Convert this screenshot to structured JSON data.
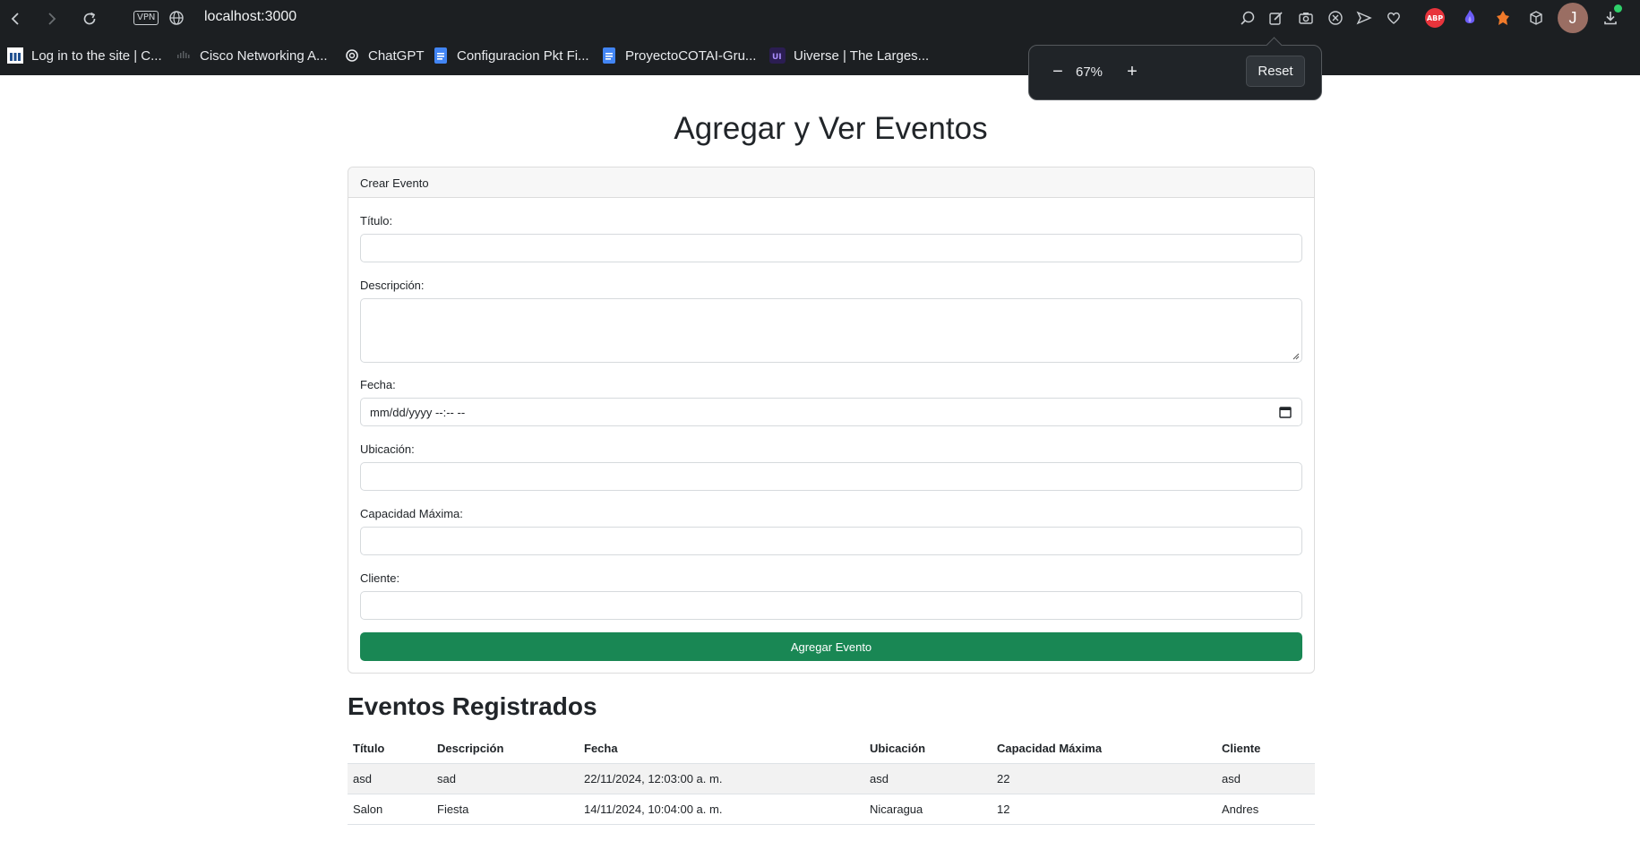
{
  "browser": {
    "url": "localhost:3000",
    "vpn_label": "VPN",
    "avatar_letter": "J",
    "abp_label": "ABP",
    "bookmarks": [
      {
        "label": "Log in to the site | C...",
        "icon": "moodle-icon"
      },
      {
        "label": "Cisco Networking A...",
        "icon": "cisco-icon"
      },
      {
        "label": "ChatGPT",
        "icon": "chatgpt-icon"
      },
      {
        "label": "Configuracion Pkt Fi...",
        "icon": "google-docs-icon"
      },
      {
        "label": "ProyectoCOTAI-Gru...",
        "icon": "google-docs-icon"
      },
      {
        "label": "Uiverse | The Larges...",
        "icon": "uiverse-icon"
      }
    ],
    "zoom": {
      "level": "67%",
      "minus": "−",
      "plus": "+",
      "reset_label": "Reset"
    }
  },
  "page": {
    "title": "Agregar y Ver Eventos",
    "form": {
      "header": "Crear Evento",
      "titulo_label": "Título:",
      "descripcion_label": "Descripción:",
      "fecha_label": "Fecha:",
      "fecha_placeholder": "mm/dd/yyyy --:-- --",
      "ubicacion_label": "Ubicación:",
      "capacidad_label": "Capacidad Máxima:",
      "cliente_label": "Cliente:",
      "submit_label": "Agregar Evento"
    },
    "events_section": {
      "title": "Eventos Registrados",
      "columns": [
        "Título",
        "Descripción",
        "Fecha",
        "Ubicación",
        "Capacidad Máxima",
        "Cliente"
      ],
      "rows": [
        [
          "asd",
          "sad",
          "22/11/2024, 12:03:00 a. m.",
          "asd",
          "22",
          "asd"
        ],
        [
          "Salon",
          "Fiesta",
          "14/11/2024, 10:04:00 a. m.",
          "Nicaragua",
          "12",
          "Andres"
        ]
      ]
    }
  },
  "colors": {
    "chrome_bg": "#1c1f22",
    "primary_green": "#198754",
    "abp_red": "#e8343c"
  }
}
